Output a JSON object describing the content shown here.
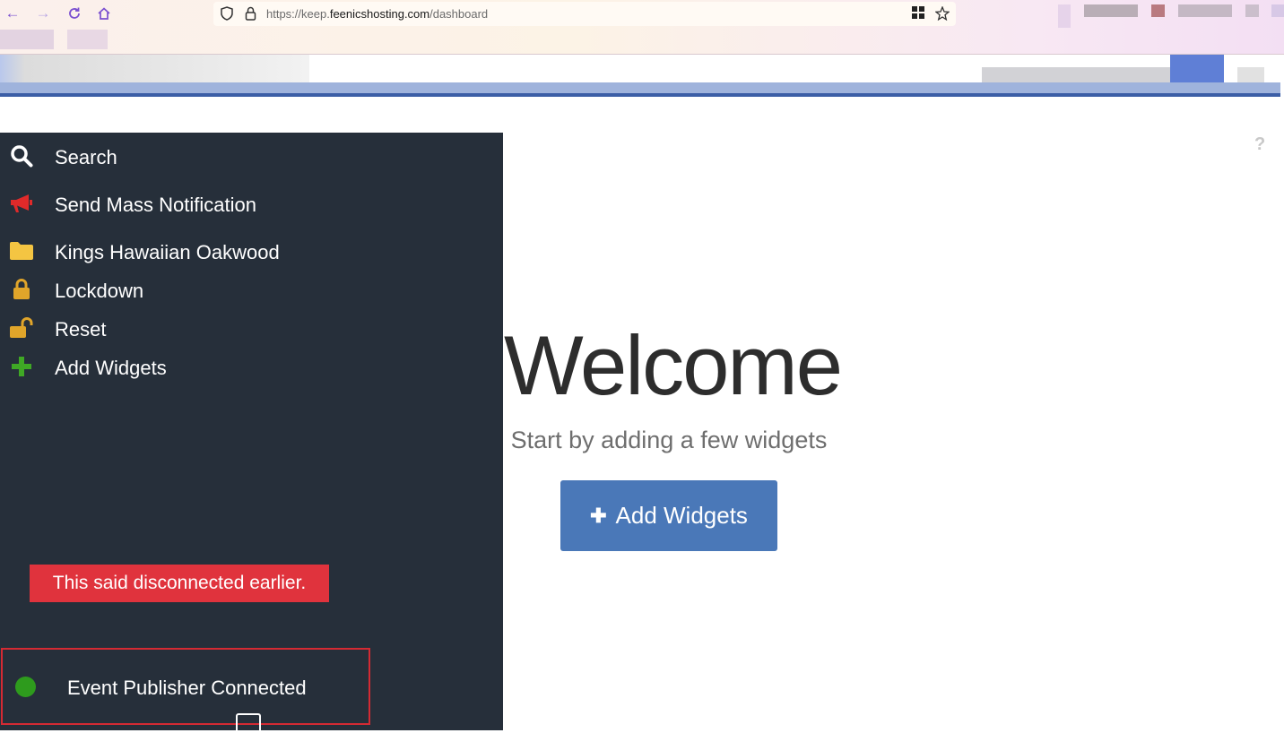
{
  "browser": {
    "url_prefix": "https://keep.",
    "url_domain": "feenicshosting.com",
    "url_path": "/dashboard",
    "icons": [
      "back-icon",
      "forward-icon",
      "reload-icon",
      "home-icon",
      "shield-icon",
      "lock-icon",
      "grid-icon",
      "star-icon"
    ]
  },
  "sidebar": {
    "items": [
      {
        "label": "Search",
        "icon": "search-icon"
      },
      {
        "label": "Send Mass Notification",
        "icon": "megaphone-icon",
        "color": "#e02a2a"
      },
      {
        "label": "Kings Hawaiian Oakwood",
        "icon": "folder-icon",
        "color": "#f4c542"
      },
      {
        "label": "Lockdown",
        "icon": "lock-icon",
        "color": "#e0a52a"
      },
      {
        "label": "Reset",
        "icon": "unlock-icon",
        "color": "#e0a52a"
      },
      {
        "label": "Add Widgets",
        "icon": "plus-icon",
        "color": "#3fa825"
      }
    ],
    "note": "This said disconnected earlier.",
    "status": {
      "label": "Event Publisher Connected",
      "color": "#2e9b1d"
    }
  },
  "main": {
    "title": "Welcome",
    "subtitle": "Start by adding a few widgets",
    "add_button_label": "Add Widgets",
    "help": "?"
  },
  "colors": {
    "sidebar_bg": "#262f3a",
    "button_bg": "#4a78b8",
    "note_bg": "#e0333d",
    "status_border": "#d42a33"
  }
}
